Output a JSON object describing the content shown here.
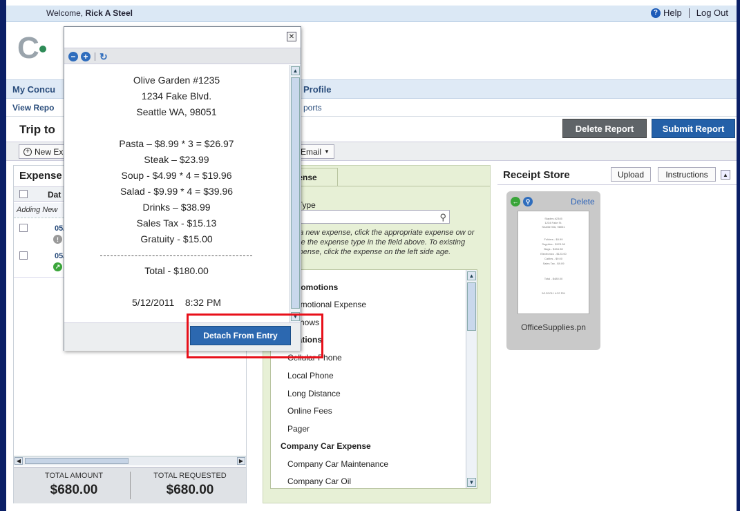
{
  "header": {
    "welcome_prefix": "Welcome,",
    "user_name": "Rick A Steel",
    "help_label": "Help",
    "logout_label": "Log Out"
  },
  "logo": {
    "text_c": "C",
    "text_rest": ""
  },
  "nav": {
    "items": [
      {
        "label": "My Concu"
      },
      {
        "label": "Profile"
      }
    ]
  },
  "subnav": {
    "items": [
      {
        "label": "View Repo"
      },
      {
        "label": "ports"
      }
    ]
  },
  "report": {
    "title": "Trip to",
    "delete_label": "Delete Report",
    "submit_label": "Submit Report"
  },
  "toolbar": {
    "new_expense_label": "New Ex",
    "email_label": "Email"
  },
  "expenses_panel": {
    "title": "Expense",
    "date_header": "Dat",
    "adding_text": "Adding New",
    "rows": [
      {
        "date": "05/",
        "icon": "warning-icon"
      },
      {
        "date": "05/",
        "icon": "receipt-attached-icon"
      }
    ],
    "total_amount_label": "TOTAL AMOUNT",
    "total_amount_value": "$680.00",
    "total_requested_label": "TOTAL REQUESTED",
    "total_requested_value": "$680.00"
  },
  "new_expense_panel": {
    "tab_label": "pense",
    "type_label": "e Type",
    "hint": "te a new expense, click the appropriate expense ow or type the expense type in the field above. To existing expense, click the expense on the left side age.",
    "list": [
      {
        "label": "ss Promotions",
        "category": true
      },
      {
        "label": "Promotional Expense",
        "category": false
      },
      {
        "label": "e Shows",
        "category": false
      },
      {
        "label": "unications",
        "category": true
      },
      {
        "label": "Cellular Phone",
        "category": false
      },
      {
        "label": "Local Phone",
        "category": false
      },
      {
        "label": "Long Distance",
        "category": false
      },
      {
        "label": "Online Fees",
        "category": false
      },
      {
        "label": "Pager",
        "category": false
      },
      {
        "label": "Company Car Expense",
        "category": true
      },
      {
        "label": "Company Car Maintenance",
        "category": false
      },
      {
        "label": "Company Car Oil",
        "category": false
      }
    ]
  },
  "receipt_store": {
    "title": "Receipt Store",
    "upload_label": "Upload",
    "instructions_label": "Instructions",
    "card": {
      "delete_label": "Delete",
      "filename": "OfficeSupplies.pn",
      "thumb_lines": [
        "Staples #2345",
        "1234 Fake St.",
        "Seattle WA, 98051",
        "",
        "Folders - $4.99",
        "Supplies - $123.98",
        "Bags - $154.98",
        "Electronics - $123.00",
        "Cables - $9.00",
        "Sales Tax - $9.09",
        "",
        "Total - $480.00",
        "",
        "5/12/2011 4:32 PM"
      ]
    }
  },
  "receipt_popup": {
    "lines": [
      "Olive Garden #1235",
      "1234 Fake Blvd.",
      "Seattle WA, 98051",
      "",
      "Pasta – $8.99 * 3 = $26.97",
      "Steak – $23.99",
      "Soup - $4.99 * 4 = $19.96",
      "Salad - $9.99 * 4 = $39.96",
      "Drinks – $38.99",
      "Sales Tax - $15.13",
      "Gratuity - $15.00"
    ],
    "total": "Total - $180.00",
    "datetime": "5/12/2011    8:32 PM",
    "detach_label": "Detach From Entry"
  },
  "colors": {
    "frame": "#0b1f66",
    "accent_blue": "#2460a8",
    "highlight_red": "#e8101a",
    "new_expense_bg": "#e7f0d6"
  }
}
